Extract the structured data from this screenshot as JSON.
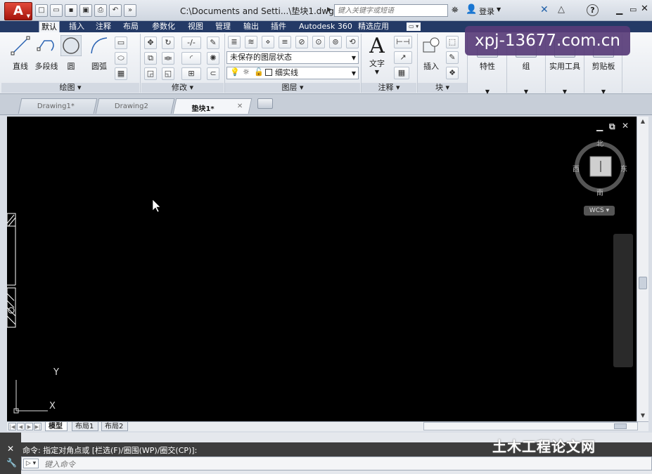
{
  "window": {
    "title": "C:\\Documents and Setti...\\垫块1.dwg",
    "search_placeholder": "键入关键字或短语",
    "login": "登录",
    "help": "?",
    "min": "▁",
    "max": "▭",
    "close": "✕"
  },
  "app_logo": "A",
  "ribbon_tabs": [
    "默认",
    "插入",
    "注释",
    "布局",
    "参数化",
    "视图",
    "管理",
    "输出",
    "插件",
    "Autodesk 360",
    "精选应用"
  ],
  "ribbon": {
    "draw": {
      "title": "绘图",
      "line": "直线",
      "polyline": "多段线",
      "circle": "圆",
      "arc": "圆弧"
    },
    "modify": {
      "title": "修改"
    },
    "layers": {
      "title": "图层",
      "layer_state": "未保存的图层状态",
      "linetype": "细实线"
    },
    "annotation": {
      "title": "注释",
      "text": "文字"
    },
    "block": {
      "title": "块",
      "insert": "插入"
    },
    "properties": "特性",
    "groups": "组",
    "utilities": "实用工具",
    "clipboard": "剪贴板"
  },
  "doc_tabs": [
    {
      "label": "Drawing1*",
      "active": false
    },
    {
      "label": "Drawing2",
      "active": false
    },
    {
      "label": "垫块1*",
      "active": true
    }
  ],
  "viewcube": {
    "north": "北",
    "south": "南",
    "east": "东",
    "west": "西",
    "wcs": "WCS"
  },
  "ucs": {
    "x": "X",
    "y": "Y"
  },
  "layout_tabs": [
    {
      "label": "模型",
      "active": true
    },
    {
      "label": "布局1",
      "active": false
    },
    {
      "label": "布局2",
      "active": false
    }
  ],
  "command": {
    "history": "命令: 指定对角点或 [栏选(F)/圈围(WP)/圈交(CP)]:",
    "placeholder": "键入命令"
  },
  "watermark": "土木工程论文网",
  "url_badge": "xpj-13677.com.cn",
  "colors": {
    "canvas": "#000000",
    "ribbon_tab_bar": "#243a66",
    "logo_red": "#c3261a"
  }
}
